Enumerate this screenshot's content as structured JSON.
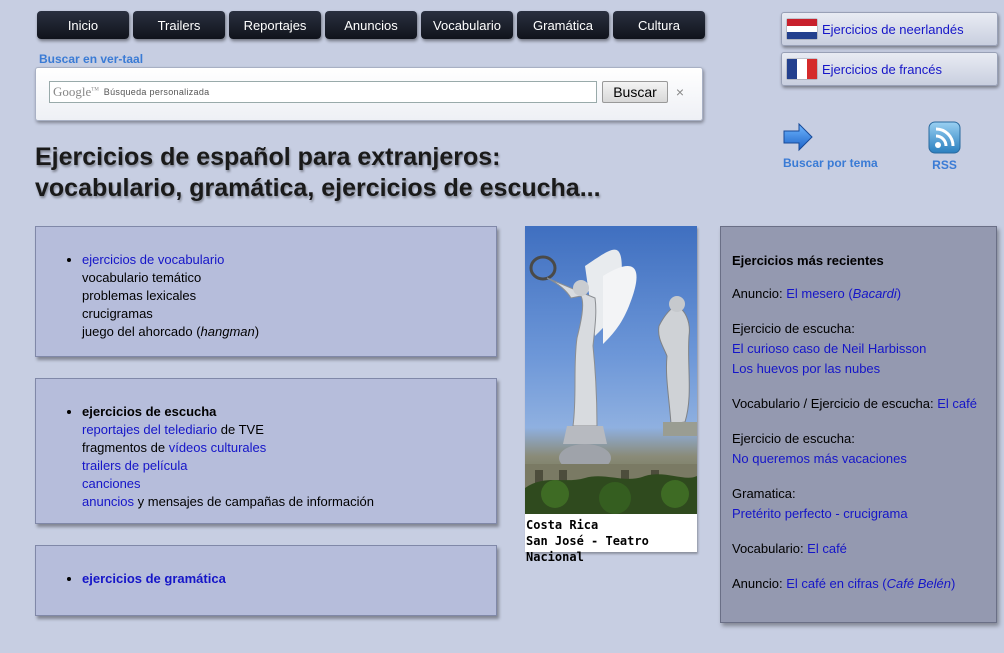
{
  "nav": [
    "Inicio",
    "Trailers",
    "Reportajes",
    "Anuncios",
    "Vocabulario",
    "Gramática",
    "Cultura"
  ],
  "search": {
    "title": "Buscar en ver-taal",
    "logo": "Google",
    "logo_tm": "TM",
    "placeholder": "Búsqueda personalizada",
    "button": "Buscar",
    "clear": "×"
  },
  "languages": {
    "dutch": "Ejercicios de neerlandés",
    "french": "Ejercicios de francés"
  },
  "icons": {
    "topic": "Buscar por tema",
    "rss": "RSS"
  },
  "headline": {
    "line1": "Ejercicios de español para extranjeros:",
    "line2": "vocabulario, gramática, ejercicios de escucha..."
  },
  "box1": {
    "heading": "ejercicios de vocabulario",
    "items": [
      "vocabulario temático",
      "problemas lexicales",
      "crucigramas"
    ],
    "hangman_pre": "juego del ahorcado (",
    "hangman_em": "hangman",
    "hangman_post": ")"
  },
  "box2": {
    "heading": "ejercicios de escucha",
    "line1_link": "reportajes del telediario",
    "line1_rest": " de TVE",
    "line2_pre": "fragmentos de ",
    "line2_link": "vídeos culturales",
    "line3": "trailers de película",
    "line4": "canciones",
    "line5_link": "anuncios",
    "line5_rest": " y mensajes de campañas de información"
  },
  "box3": {
    "heading": "ejercicios de gramática"
  },
  "photo": {
    "caption1": "Costa Rica",
    "caption2": "San José - Teatro Nacional"
  },
  "recent": {
    "title": "Ejercicios más recientes",
    "e1_label": "Anuncio: ",
    "e1_link": "El mesero (",
    "e1_em": "Bacardi",
    "e1_close": ")",
    "e2_label": "Ejercicio de escucha:",
    "e2_link1": "El curioso caso de Neil Harbisson",
    "e2_link2": "Los huevos por las nubes",
    "e3_label": "Vocabulario / Ejercicio de escucha: ",
    "e3_link": "El café",
    "e4_label": "Ejercicio de escucha:",
    "e4_link": "No queremos más vacaciones",
    "e5_label": "Gramatica:",
    "e5_link": "Pretérito perfecto - crucigrama",
    "e6_label": "Vocabulario: ",
    "e6_link": "El café",
    "e7_label": "Anuncio: ",
    "e7_link": "El café en cifras (",
    "e7_em": "Café Belén",
    "e7_close": ")"
  },
  "colors": {
    "background": "#c7cee2",
    "link": "#1515c8",
    "accent": "#3a7bd5",
    "box": "#b6bddb",
    "sidebar": "#9499b0"
  }
}
